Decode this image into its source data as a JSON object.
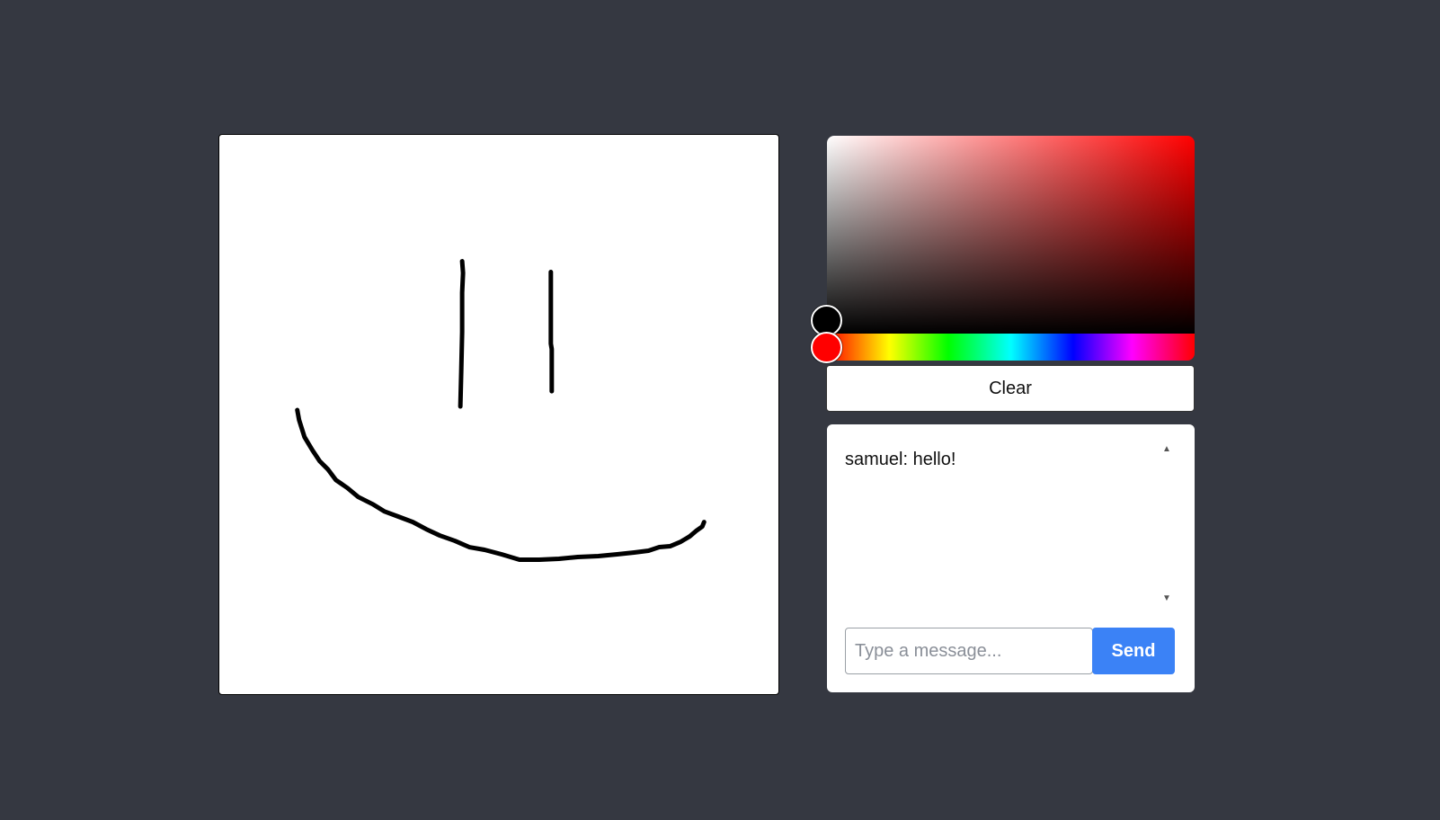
{
  "canvas": {
    "stroke_color": "#000000",
    "background": "#ffffff"
  },
  "color_picker": {
    "selected_color": "#000000",
    "hue_color": "#ff0000"
  },
  "toolbar": {
    "clear_label": "Clear"
  },
  "chat": {
    "messages": [
      {
        "text": "samuel: hello!"
      }
    ],
    "input_placeholder": "Type a message...",
    "input_value": "",
    "send_label": "Send",
    "accent": "#3b82f6"
  },
  "icons": {
    "scroll_up": "▲",
    "scroll_down": "▼"
  }
}
